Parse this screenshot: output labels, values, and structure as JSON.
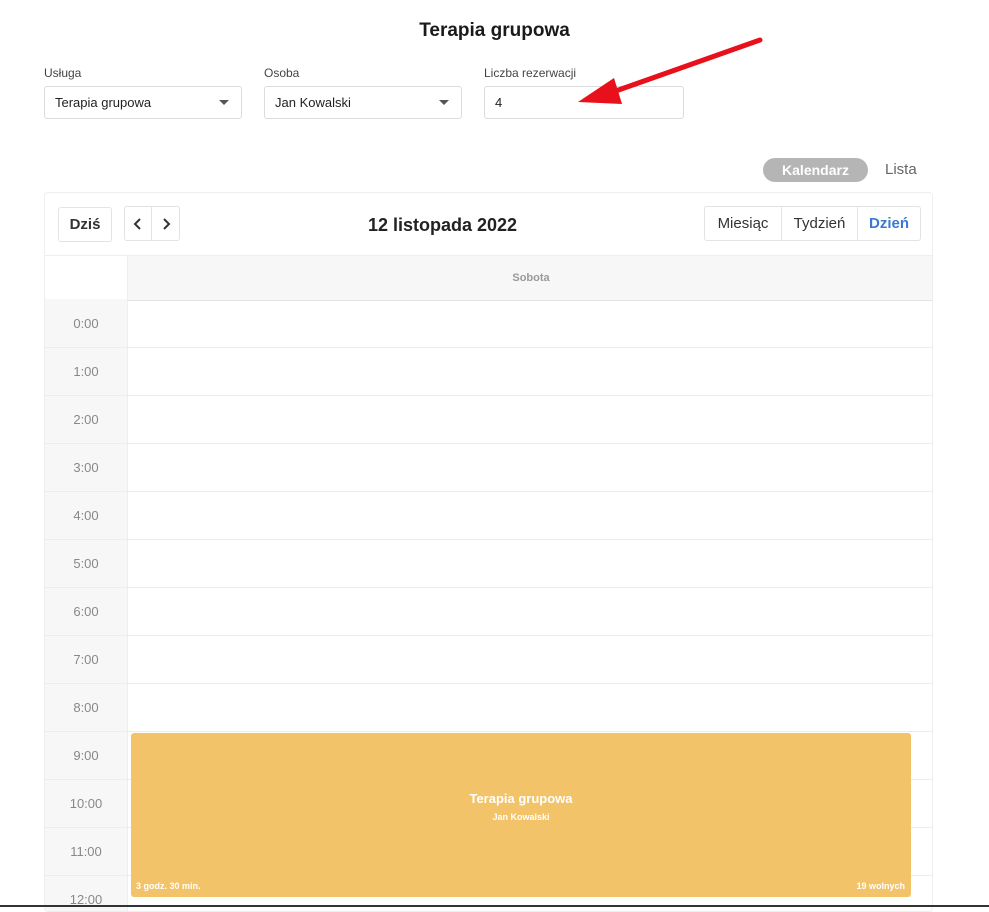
{
  "page": {
    "title": "Terapia grupowa"
  },
  "filters": {
    "service": {
      "label": "Usługa",
      "value": "Terapia grupowa"
    },
    "person": {
      "label": "Osoba",
      "value": "Jan Kowalski"
    },
    "count": {
      "label": "Liczba rezerwacji",
      "value": "4"
    }
  },
  "view_toggle": {
    "calendar": "Kalendarz",
    "list": "Lista",
    "active": "Kalendarz"
  },
  "calendar": {
    "toolbar": {
      "today": "Dziś",
      "prev_icon": "chevron-left-icon",
      "next_icon": "chevron-right-icon",
      "title": "12 listopada 2022",
      "views": [
        "Miesiąc",
        "Tydzień",
        "Dzień"
      ],
      "active_view": "Dzień"
    },
    "day_header": "Sobota",
    "hours": [
      "0:00",
      "1:00",
      "2:00",
      "3:00",
      "4:00",
      "5:00",
      "6:00",
      "7:00",
      "8:00",
      "9:00",
      "10:00",
      "11:00",
      "12:00"
    ],
    "event": {
      "title": "Terapia grupowa",
      "person": "Jan Kowalski",
      "duration": "3 godz. 30 min.",
      "free_slots": "19 wolnych",
      "color": "#f3c369"
    }
  },
  "colors": {
    "accent": "#3a78d6",
    "toggle_active": "#b5b5b5",
    "annotation_arrow": "#e8101a"
  }
}
